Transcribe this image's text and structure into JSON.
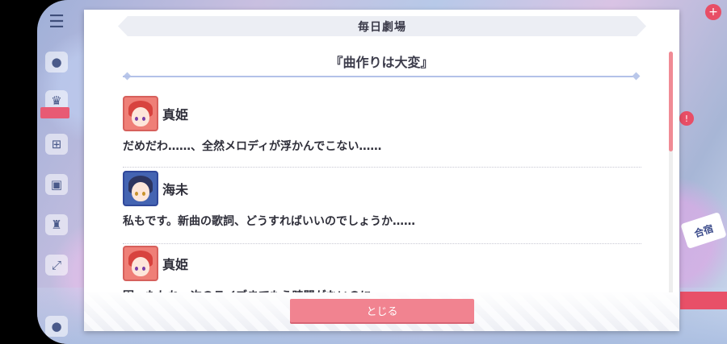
{
  "dialog": {
    "header_title": "毎日劇場",
    "episode_title": "『曲作りは大変』",
    "close_label": "とじる"
  },
  "lines": [
    {
      "speaker": "真姫",
      "text": "だめだわ……、全然メロディが浮かんでこない……"
    },
    {
      "speaker": "海未",
      "text": "私もです。新曲の歌詞、どうすればいいのでしょうか……"
    },
    {
      "speaker": "真姫",
      "text": "困ったわね、次のライブまでもう時間がないのに"
    }
  ],
  "background": {
    "right_button_label": "合宿"
  },
  "colors": {
    "accent": "#f18390",
    "header_bg": "#eceef4",
    "divider": "#b3c1e8"
  }
}
